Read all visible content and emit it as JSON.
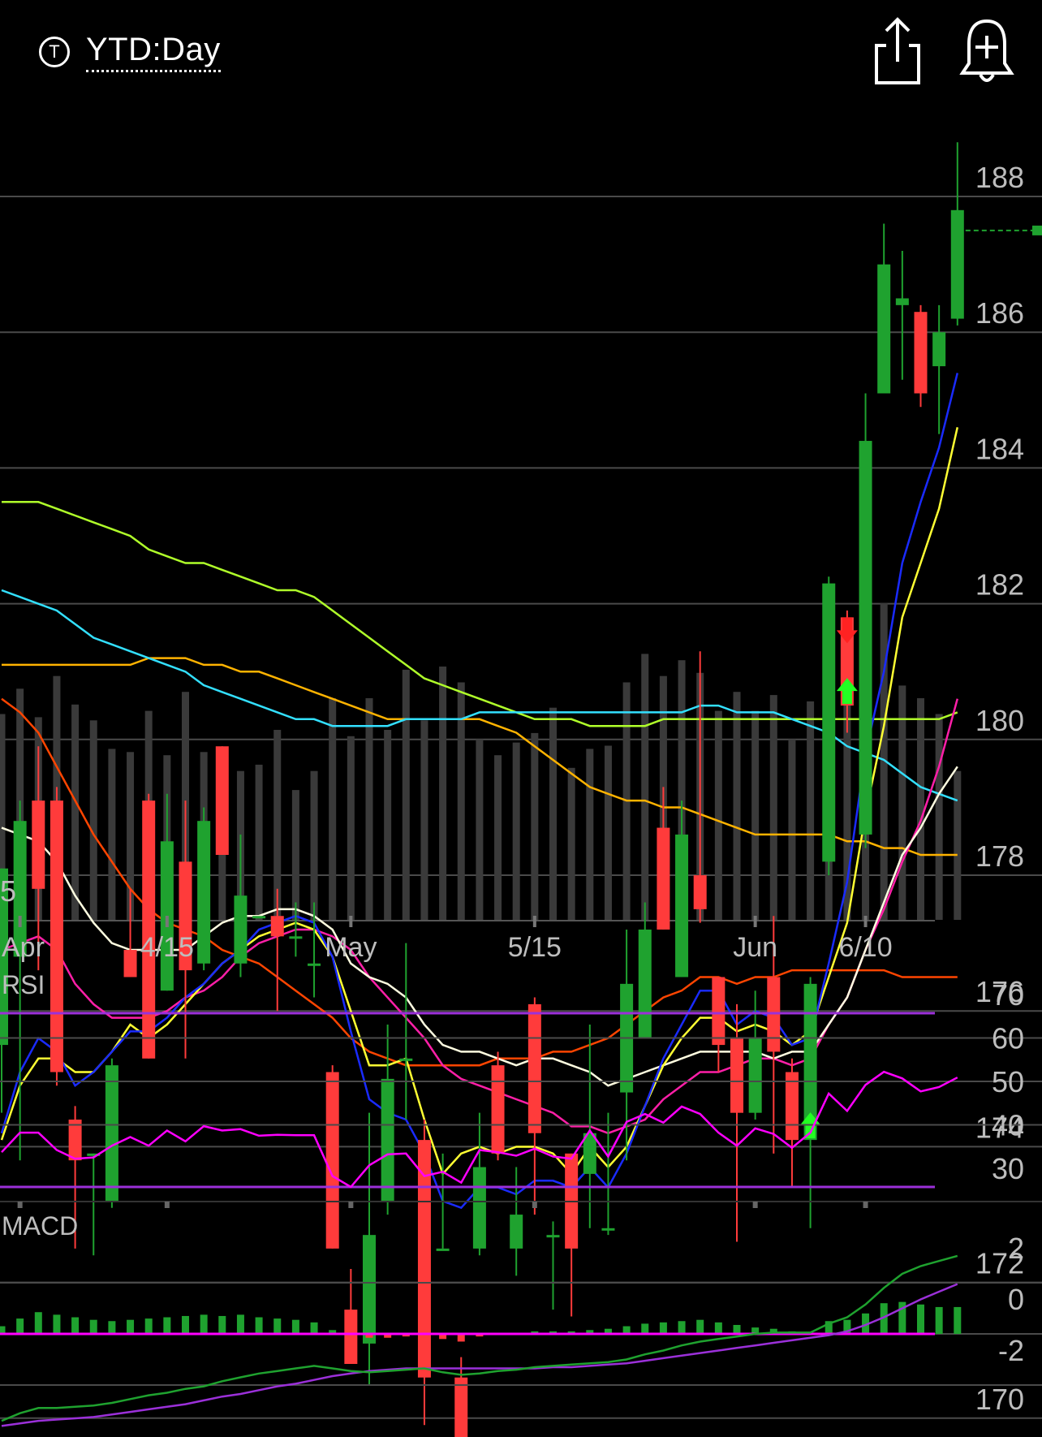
{
  "header": {
    "period_label": "YTD:Day",
    "period_icon_glyph": "T",
    "share_icon": "share-icon",
    "alert_icon": "add-alert-bell-icon"
  },
  "colors": {
    "background": "#000000",
    "grid": "#4a4a4a",
    "up_candle": "#1fa22f",
    "down_candle": "#ff3b3b",
    "volume": "#3a3a3a",
    "ma_blue": "#1a2bff",
    "ma_yellow": "#ffff33",
    "ma_white": "#fffde0",
    "ma_magenta": "#ff1fa8",
    "ma_orange": "#ff4500",
    "ma_cyan": "#33e0ff",
    "ma_green": "#b0ff2a",
    "ma_gold": "#ffb300",
    "rsi_line": "#ff00ff",
    "rsi_bounds": "#9b30d9",
    "macd_line": "#1fa22f",
    "signal_line": "#9b30d9",
    "hist_zero": "#ff00ff",
    "buy_arrow": "#22ff22",
    "sell_arrow": "#ff2222"
  },
  "chart_data": [
    {
      "type": "candlestick",
      "x_ticks": [
        "Apr",
        "4/15",
        "May",
        "5/15",
        "Jun",
        "6/10"
      ],
      "y_ticks": [
        "188",
        "186",
        "184",
        "182",
        "180",
        "178",
        "176",
        "174",
        "172",
        "170"
      ],
      "ylim": [
        167,
        189
      ],
      "last_price": 187.2,
      "candles": [
        [
          175.2,
          177.8,
          177.8,
          174.2
        ],
        [
          176.5,
          178.5,
          178.8,
          173.5
        ],
        [
          178.8,
          177.5,
          179.6,
          176.3
        ],
        [
          178.8,
          174.8,
          179,
          174.6
        ],
        [
          174.1,
          173.5,
          174.3,
          172.2
        ],
        [
          173.6,
          173.6,
          173.6,
          172.1
        ],
        [
          172.9,
          174.9,
          175,
          172.8
        ],
        [
          176.6,
          176.2,
          177.5,
          176.2
        ],
        [
          178.8,
          175,
          178.9,
          175
        ],
        [
          176,
          178.2,
          178.9,
          176
        ],
        [
          177.9,
          176.3,
          178.8,
          175
        ],
        [
          176.4,
          178.5,
          178.7,
          176.3
        ],
        [
          179.6,
          178,
          179.6,
          178
        ],
        [
          176.4,
          177.4,
          178.3,
          176.2
        ],
        [
          177.1,
          177.1,
          177.1,
          177.1
        ],
        [
          177.1,
          176.8,
          177.5,
          175.7
        ],
        [
          176.8,
          176.8,
          177.3,
          176.5
        ],
        [
          176.4,
          176.4,
          177.3,
          175.9
        ],
        [
          174.8,
          172.2,
          174.9,
          172.2
        ],
        [
          171.3,
          170.5,
          171.9,
          170.5
        ],
        [
          170.8,
          172.4,
          174.2,
          170.2
        ],
        [
          172.9,
          174.7,
          175.5,
          172.7
        ],
        [
          175,
          175,
          176.7,
          174.1
        ],
        [
          173.8,
          170.3,
          174.1,
          169.6
        ],
        [
          172.2,
          172.2,
          173.6,
          172.2
        ],
        [
          170.3,
          169.3,
          170.6,
          168.6
        ],
        [
          172.2,
          173.4,
          174.2,
          172.1
        ],
        [
          174.9,
          173.6,
          175.1,
          173.5
        ],
        [
          172.2,
          172.7,
          173.4,
          171.8
        ],
        [
          175.8,
          173.9,
          175.9,
          172.7
        ],
        [
          172.4,
          172.4,
          172.6,
          171.3
        ],
        [
          173.6,
          172.2,
          173.6,
          171.2
        ],
        [
          173.3,
          173.9,
          175.5,
          172.5
        ],
        [
          172.5,
          172.5,
          174.2,
          172.4
        ],
        [
          174.5,
          176.1,
          176.9,
          173.5
        ],
        [
          175.3,
          176.9,
          177.3,
          175.3
        ],
        [
          178.4,
          176.9,
          179,
          176.9
        ],
        [
          176.2,
          178.3,
          178.8,
          176.2
        ],
        [
          177.7,
          177.2,
          181,
          177
        ],
        [
          176.2,
          175.2,
          176.2,
          174.8
        ],
        [
          175.3,
          174.2,
          175.8,
          172.3
        ],
        [
          174.2,
          175.3,
          176,
          174.1
        ],
        [
          176.2,
          175.1,
          177.1,
          173.6
        ],
        [
          174.8,
          173.8,
          175,
          173.1
        ],
        [
          173.8,
          176.1,
          176.2,
          172.5
        ],
        [
          177.9,
          182,
          182.1,
          177.7
        ],
        [
          181.5,
          180.2,
          181.6,
          179.8
        ],
        [
          178.3,
          184.1,
          184.8,
          178.1
        ],
        [
          184.8,
          186.7,
          187.3,
          184.8
        ],
        [
          186.1,
          186.2,
          186.9,
          185
        ],
        [
          186,
          184.8,
          186.1,
          184.6
        ],
        [
          185.2,
          185.7,
          186.1,
          184.2
        ],
        [
          185.9,
          187.5,
          188.5,
          185.8
        ]
      ],
      "volume": [
        0.65,
        0.73,
        0.64,
        0.77,
        0.68,
        0.63,
        0.54,
        0.53,
        0.66,
        0.52,
        0.72,
        0.53,
        0.54,
        0.47,
        0.49,
        0.6,
        0.41,
        0.47,
        0.7,
        0.58,
        0.7,
        0.6,
        0.79,
        0.63,
        0.8,
        0.75,
        0.57,
        0.52,
        0.56,
        0.59,
        0.67,
        0.48,
        0.54,
        0.55,
        0.75,
        0.84,
        0.77,
        0.82,
        0.78,
        0.66,
        0.72,
        0.66,
        0.71,
        0.57,
        0.69,
        0.77,
        0.84,
        1.0,
        1.0,
        0.74,
        0.7,
        0.65,
        0.47
      ],
      "signals": [
        {
          "bar": 44,
          "type": "buy"
        },
        {
          "bar": 46,
          "type": "sell"
        },
        {
          "bar": 46,
          "type": "buy"
        }
      ],
      "moving_averages": [
        {
          "color": "blue",
          "values": [
            173.9,
            174.8,
            175.3,
            175.1,
            174.6,
            174.8,
            175.1,
            175.4,
            175.4,
            175.6,
            175.9,
            176.1,
            176.4,
            176.6,
            176.9,
            177,
            177.1,
            177,
            176.5,
            175.4,
            174.4,
            174.2,
            174.1,
            173.6,
            172.9,
            172.8,
            173.1,
            173.1,
            173,
            173.2,
            173.2,
            173.1,
            173.4,
            173.1,
            173.6,
            174.3,
            175,
            175.5,
            176,
            176,
            175.5,
            175.7,
            175.6,
            175.2,
            175.3,
            176.4,
            177.6,
            179.5,
            180.7,
            182.3,
            183.2,
            184,
            185.1
          ]
        },
        {
          "color": "yellow",
          "values": [
            173.8,
            174.6,
            175,
            175,
            174.8,
            174.8,
            175.1,
            175.5,
            175.3,
            175.5,
            175.8,
            176.1,
            176.4,
            176.6,
            176.8,
            176.9,
            177,
            176.9,
            176.5,
            175.7,
            174.9,
            174.9,
            175,
            174.1,
            173.3,
            173.6,
            173.7,
            173.6,
            173.7,
            173.7,
            173.6,
            173.3,
            173.7,
            173.4,
            173.7,
            174.3,
            174.9,
            175.3,
            175.6,
            175.6,
            175.4,
            175.5,
            175.4,
            175.2,
            175.4,
            176.2,
            177,
            178.6,
            179.9,
            181.5,
            182.3,
            183.1,
            184.3
          ]
        },
        {
          "color": "white",
          "values": [
            178.4,
            178.3,
            178.2,
            177.9,
            177.4,
            177,
            176.7,
            176.6,
            176.6,
            176.6,
            176.6,
            176.8,
            177,
            177.1,
            177.1,
            177.2,
            177.2,
            177.1,
            176.9,
            176.4,
            176.2,
            176.1,
            175.9,
            175.5,
            175.2,
            175.1,
            175.1,
            175,
            174.9,
            175,
            175,
            174.9,
            174.8,
            174.6,
            174.7,
            174.8,
            174.9,
            175,
            175.1,
            175.1,
            175.1,
            175.1,
            175,
            175.1,
            175.1,
            175.5,
            175.9,
            176.6,
            177.3,
            178,
            178.4,
            178.9,
            179.3
          ]
        },
        {
          "color": "magenta",
          "values": [
            176.6,
            176.7,
            176.8,
            176.6,
            176.1,
            175.8,
            175.6,
            175.6,
            175.6,
            175.7,
            175.9,
            176,
            176.2,
            176.5,
            176.7,
            176.8,
            176.9,
            176.9,
            176.8,
            176.6,
            176.2,
            175.9,
            175.6,
            175.3,
            174.9,
            174.7,
            174.6,
            174.5,
            174.4,
            174.3,
            174.2,
            174,
            174,
            173.9,
            174,
            174.1,
            174.4,
            174.6,
            174.8,
            174.8,
            174.9,
            175,
            175,
            174.9,
            175,
            175.5,
            175.9,
            176.6,
            177.2,
            177.9,
            178.5,
            179.3,
            180.3
          ]
        },
        {
          "color": "orange",
          "values": [
            180.3,
            180.1,
            179.8,
            179.3,
            178.8,
            178.3,
            177.9,
            177.5,
            177.2,
            177,
            176.9,
            176.8,
            176.6,
            176.5,
            176.4,
            176.2,
            176,
            175.8,
            175.6,
            175.3,
            175.1,
            175,
            174.9,
            174.9,
            174.9,
            174.9,
            174.9,
            175,
            175,
            175,
            175.1,
            175.1,
            175.2,
            175.3,
            175.5,
            175.7,
            175.9,
            176,
            176.2,
            176.2,
            176.1,
            176.2,
            176.2,
            176.3,
            176.3,
            176.3,
            176.3,
            176.3,
            176.3,
            176.2,
            176.2,
            176.2,
            176.2
          ]
        },
        {
          "color": "cyan",
          "values": [
            181.9,
            181.8,
            181.7,
            181.6,
            181.4,
            181.2,
            181.1,
            181,
            180.9,
            180.8,
            180.7,
            180.5,
            180.4,
            180.3,
            180.2,
            180.1,
            180,
            180,
            179.9,
            179.9,
            179.9,
            179.9,
            180,
            180,
            180,
            180,
            180.1,
            180.1,
            180.1,
            180.1,
            180.1,
            180.1,
            180.1,
            180.1,
            180.1,
            180.1,
            180.1,
            180.1,
            180.2,
            180.2,
            180.1,
            180.1,
            180.1,
            180,
            179.9,
            179.8,
            179.6,
            179.5,
            179.4,
            179.2,
            179,
            178.9,
            178.8
          ]
        },
        {
          "color": "green",
          "values": [
            183.2,
            183.2,
            183.2,
            183.1,
            183,
            182.9,
            182.8,
            182.7,
            182.5,
            182.4,
            182.3,
            182.3,
            182.2,
            182.1,
            182,
            181.9,
            181.9,
            181.8,
            181.6,
            181.4,
            181.2,
            181,
            180.8,
            180.6,
            180.5,
            180.4,
            180.3,
            180.2,
            180.1,
            180,
            180,
            180,
            179.9,
            179.9,
            179.9,
            179.9,
            180,
            180,
            180,
            180,
            180,
            180,
            180,
            180,
            180,
            180,
            180,
            180,
            180,
            180,
            180,
            180,
            180.1
          ]
        },
        {
          "color": "gold",
          "values": [
            180.8,
            180.8,
            180.8,
            180.8,
            180.8,
            180.8,
            180.8,
            180.8,
            180.9,
            180.9,
            180.9,
            180.8,
            180.8,
            180.7,
            180.7,
            180.6,
            180.5,
            180.4,
            180.3,
            180.2,
            180.1,
            180,
            180,
            180,
            180,
            180,
            180,
            179.9,
            179.8,
            179.6,
            179.4,
            179.2,
            179,
            178.9,
            178.8,
            178.8,
            178.7,
            178.7,
            178.6,
            178.5,
            178.4,
            178.3,
            178.3,
            178.3,
            178.3,
            178.3,
            178.2,
            178.2,
            178.1,
            178.1,
            178,
            178,
            178
          ]
        }
      ]
    },
    {
      "type": "line",
      "title": "RSI",
      "y_ticks": [
        "70",
        "60",
        "50",
        "40",
        "30"
      ],
      "ylim": [
        28,
        72
      ],
      "bounds": [
        70,
        30
      ],
      "values": [
        38,
        42.5,
        42.5,
        38.5,
        36.5,
        36.8,
        39.5,
        41.5,
        39.5,
        43,
        40.5,
        44,
        43,
        43.3,
        41.8,
        42,
        41.9,
        41.9,
        32.5,
        30,
        35,
        37.5,
        37.7,
        32.5,
        33.5,
        31,
        38.5,
        38,
        37.2,
        38.8,
        37,
        36.5,
        43,
        37,
        45,
        46.8,
        44.8,
        48.5,
        46.8,
        42.5,
        39.5,
        43.5,
        42.2,
        39,
        42.5,
        51.5,
        47.5,
        53.5,
        56.5,
        55,
        52,
        53,
        55.2
      ]
    },
    {
      "type": "macd",
      "title": "MACD",
      "y_ticks": [
        "2",
        "0",
        "-2"
      ],
      "ylim": [
        -3.8,
        3.8
      ],
      "histogram": [
        0.3,
        0.6,
        0.85,
        0.75,
        0.65,
        0.55,
        0.5,
        0.55,
        0.6,
        0.65,
        0.7,
        0.75,
        0.7,
        0.75,
        0.65,
        0.6,
        0.55,
        0.45,
        0.15,
        -0.1,
        -0.15,
        -0.15,
        -0.1,
        -0.15,
        -0.2,
        -0.3,
        -0.1,
        0,
        0,
        0.1,
        0.1,
        0.1,
        0.15,
        0.2,
        0.3,
        0.4,
        0.45,
        0.5,
        0.55,
        0.45,
        0.35,
        0.25,
        0.2,
        0.1,
        0.05,
        0.5,
        0.55,
        0.8,
        1.2,
        1.25,
        1.15,
        1.05,
        1.05
      ]
    }
  ]
}
